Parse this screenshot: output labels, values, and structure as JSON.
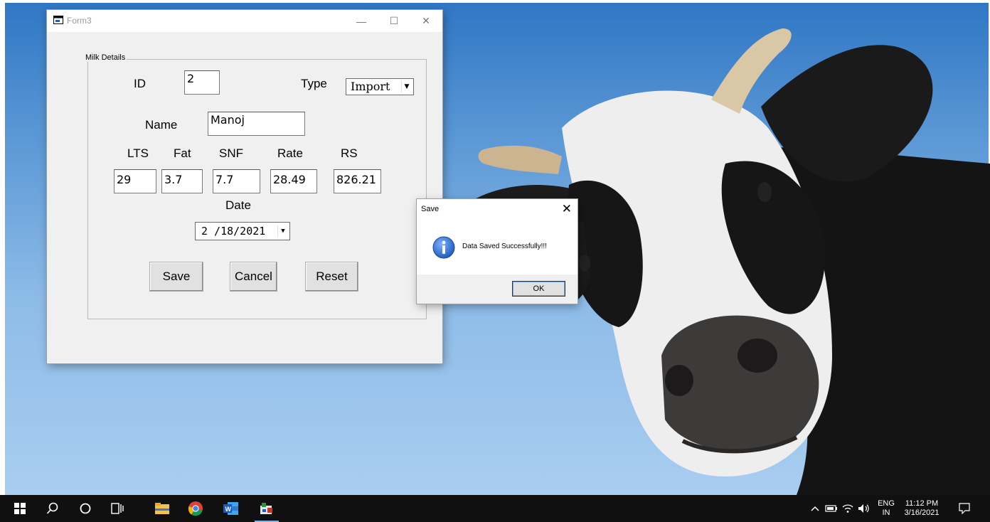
{
  "form": {
    "title": "Form3",
    "group_title": "Milk Details",
    "id_label": "ID",
    "id_value": "2",
    "type_label": "Type",
    "type_value": "Import",
    "name_label": "Name",
    "name_value": "Manoj",
    "lts_label": "LTS",
    "fat_label": "Fat",
    "snf_label": "SNF",
    "rate_label": "Rate",
    "rs_label": "RS",
    "lts_value": "29",
    "fat_value": "3.7",
    "snf_value": "7.7",
    "rate_value": "28.49",
    "rs_value": "826.21",
    "date_label": "Date",
    "date_value": "2 /18/2021",
    "save_label": "Save",
    "cancel_label": "Cancel",
    "reset_label": "Reset",
    "minimize_glyph": "—",
    "maximize_glyph": "☐",
    "close_glyph": "✕"
  },
  "dialog": {
    "title": "Save",
    "message": "Data Saved Successfully!!!",
    "ok_label": "OK",
    "close_glyph": "✕",
    "icon": "info-icon"
  },
  "taskbar": {
    "language": "ENG",
    "region": "IN",
    "time": "11:12 PM",
    "date": "3/16/2021",
    "icons": [
      "windows-start-icon",
      "search-icon",
      "cortana-icon",
      "task-view-icon",
      "file-explorer-icon",
      "chrome-icon",
      "word-icon",
      "vb-app-icon"
    ],
    "tray_icons": [
      "chevron-up-icon",
      "battery-icon",
      "wifi-icon",
      "volume-icon",
      "notification-icon"
    ]
  },
  "colors": {
    "sky_top": "#2f76c4",
    "sky_bottom": "#a9cdf0",
    "taskbar": "#101010",
    "form_bg": "#f0f0f0",
    "info_icon_blue": "#1f5fbf"
  }
}
